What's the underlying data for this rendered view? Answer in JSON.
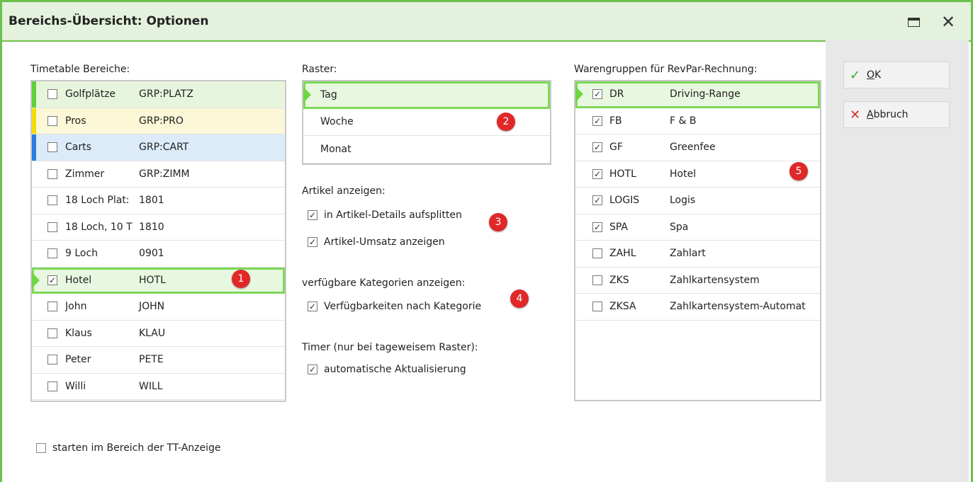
{
  "window": {
    "title": "Bereichs-Übersicht: Optionen",
    "maximize_icon": "maximize-icon",
    "close_icon": "close-icon"
  },
  "colors": {
    "accent": "#6cc04a",
    "selection": "#7dd957",
    "badge": "#e02828",
    "yellow": "#f5dd00",
    "blue": "#2a7de1"
  },
  "timetable": {
    "label": "Timetable Bereiche:",
    "rows": [
      {
        "name": "Golfplätze",
        "code": "GRP:PLATZ",
        "checked": false,
        "bg": "#e8f5dd",
        "bar": "#5fd03a"
      },
      {
        "name": "Pros",
        "code": "GRP:PRO",
        "checked": false,
        "bg": "#fbf7d7",
        "bar": "#f5dd00"
      },
      {
        "name": "Carts",
        "code": "GRP:CART",
        "checked": false,
        "bg": "#dcebfa",
        "bar": "#2a7de1"
      },
      {
        "name": "Zimmer",
        "code": "GRP:ZIMM",
        "checked": false
      },
      {
        "name": "18 Loch Plat:",
        "code": "1801",
        "checked": false
      },
      {
        "name": "18 Loch, 10 T",
        "code": "1810",
        "checked": false
      },
      {
        "name": "9 Loch",
        "code": "0901",
        "checked": false
      },
      {
        "name": "Hotel",
        "code": "HOTL",
        "checked": true,
        "selected": true
      },
      {
        "name": "John",
        "code": "JOHN",
        "checked": false
      },
      {
        "name": "Klaus",
        "code": "KLAU",
        "checked": false
      },
      {
        "name": "Peter",
        "code": "PETE",
        "checked": false
      },
      {
        "name": "Willi",
        "code": "WILL",
        "checked": false
      }
    ],
    "badge": "1"
  },
  "raster": {
    "label": "Raster:",
    "items": [
      "Tag",
      "Woche",
      "Monat"
    ],
    "selected": 0,
    "badge": "2"
  },
  "artikel": {
    "label": "Artikel anzeigen:",
    "options": [
      {
        "text": "in Artikel-Details aufsplitten",
        "checked": true
      },
      {
        "text": "Artikel-Umsatz anzeigen",
        "checked": true
      }
    ],
    "badge": "3"
  },
  "kategorien": {
    "label": "verfügbare Kategorien anzeigen:",
    "option": {
      "text": "Verfügbarkeiten nach Kategorie",
      "checked": true
    },
    "badge": "4"
  },
  "timer": {
    "label": "Timer (nur bei tageweisem Raster):",
    "option": {
      "text": "automatische Aktualisierung",
      "checked": true
    }
  },
  "warengruppen": {
    "label": "Warengruppen für RevPar-Rechnung:",
    "rows": [
      {
        "code": "DR",
        "name": "Driving-Range",
        "checked": true,
        "selected": true
      },
      {
        "code": "FB",
        "name": "F & B",
        "checked": true
      },
      {
        "code": "GF",
        "name": "Greenfee",
        "checked": true
      },
      {
        "code": "HOTL",
        "name": "Hotel",
        "checked": true
      },
      {
        "code": "LOGIS",
        "name": "Logis",
        "checked": true
      },
      {
        "code": "SPA",
        "name": "Spa",
        "checked": true
      },
      {
        "code": "ZAHL",
        "name": "Zahlart",
        "checked": false
      },
      {
        "code": "ZKS",
        "name": "Zahlkartensystem",
        "checked": false
      },
      {
        "code": "ZKSA",
        "name": "Zahlkartensystem-Automat",
        "checked": false
      }
    ],
    "badge": "5"
  },
  "starten": {
    "text": "starten im Bereich der TT-Anzeige",
    "checked": false
  },
  "buttons": {
    "ok": {
      "label_pre": "",
      "label_key": "O",
      "label_post": "K",
      "icon": "check-icon"
    },
    "cancel": {
      "label_pre": "",
      "label_key": "A",
      "label_post": "bbruch",
      "icon": "x-icon"
    }
  }
}
